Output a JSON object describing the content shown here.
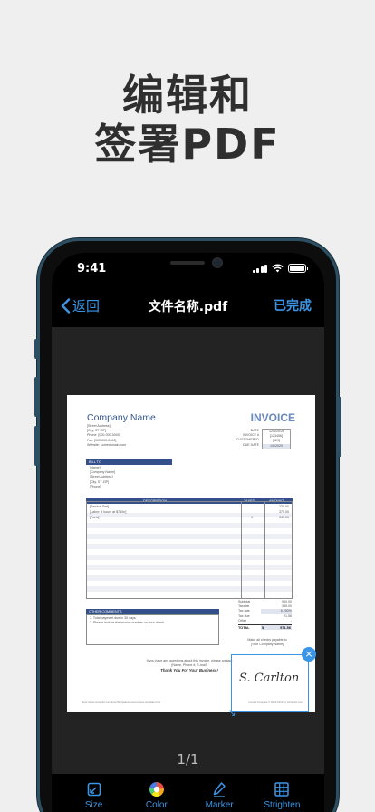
{
  "headline": {
    "line1": "编辑和",
    "line2": "签署PDF"
  },
  "statusbar": {
    "time": "9:41"
  },
  "navbar": {
    "back_label": "返回",
    "title": "文件名称.pdf",
    "done_label": "已完成"
  },
  "invoice": {
    "company": "Company Name",
    "title": "INVOICE",
    "address_lines": [
      "[Street Address]",
      "[City, ST ZIP]",
      "Phone: [000-000-0000]",
      "Fax: [000-000-0000]",
      "Website: somedomain.com"
    ],
    "meta_labels": [
      "DATE",
      "INVOICE #",
      "CUSTOMER ID",
      "DUE DATE"
    ],
    "meta_values": [
      "12/8/2019",
      "[123456]",
      "[123]",
      "1/8/2020"
    ],
    "bill_to_header": "BILL TO",
    "bill_to_lines": [
      "[Name]",
      "[Company Name]",
      "[Street Address]",
      "[City, ST ZIP]",
      "[Phone]"
    ],
    "table_headers": [
      "DESCRIPTION",
      "TAXED",
      "AMOUNT"
    ],
    "table_rows": [
      {
        "desc": "[Service Fee]",
        "taxed": "",
        "amount": "230.00"
      },
      {
        "desc": "[Labor: 5 hours at $75/hr]",
        "taxed": "",
        "amount": "375.00"
      },
      {
        "desc": "[Parts]",
        "taxed": "X",
        "amount": "345.00"
      }
    ],
    "totals_labels": [
      "Subtotal",
      "Taxable",
      "Tax rate",
      "Tax due",
      "Other"
    ],
    "totals_values": [
      "950.00",
      "345.00",
      "6.250%",
      "21.56",
      "-"
    ],
    "total_label": "TOTAL",
    "total_currency": "$",
    "total_value": "971.56",
    "comments_header": "OTHER COMMENTS",
    "comments_lines": [
      "1. Total payment due in 30 days",
      "2. Please include the invoice number on your check"
    ],
    "payable_lines": [
      "Make all checks payable to",
      "[Your Company Name]"
    ],
    "footer_lines": [
      "If you have any questions about this invoice, please contact",
      "[Name, Phone #, E-mail]"
    ],
    "thanks": "Thank You For Your Business!",
    "footer_url": "https://www.vertex42.com/ExcelTemplates/excel-invoice-template.html",
    "footer_copyright": "Invoice Template © 2015-2019 by Vertex42.com",
    "signature_text": "S. Carlton"
  },
  "page_indicator": "1/1",
  "toolbar": {
    "items": [
      {
        "label": "Size",
        "icon": "size-icon"
      },
      {
        "label": "Color",
        "icon": "color-wheel-icon"
      },
      {
        "label": "Marker",
        "icon": "marker-icon"
      },
      {
        "label": "Strighten",
        "icon": "grid-icon"
      }
    ]
  },
  "colors": {
    "accent": "#3b95e6",
    "invoice_blue": "#34508a",
    "headline": "#2f2f2f",
    "background": "#efefef"
  }
}
